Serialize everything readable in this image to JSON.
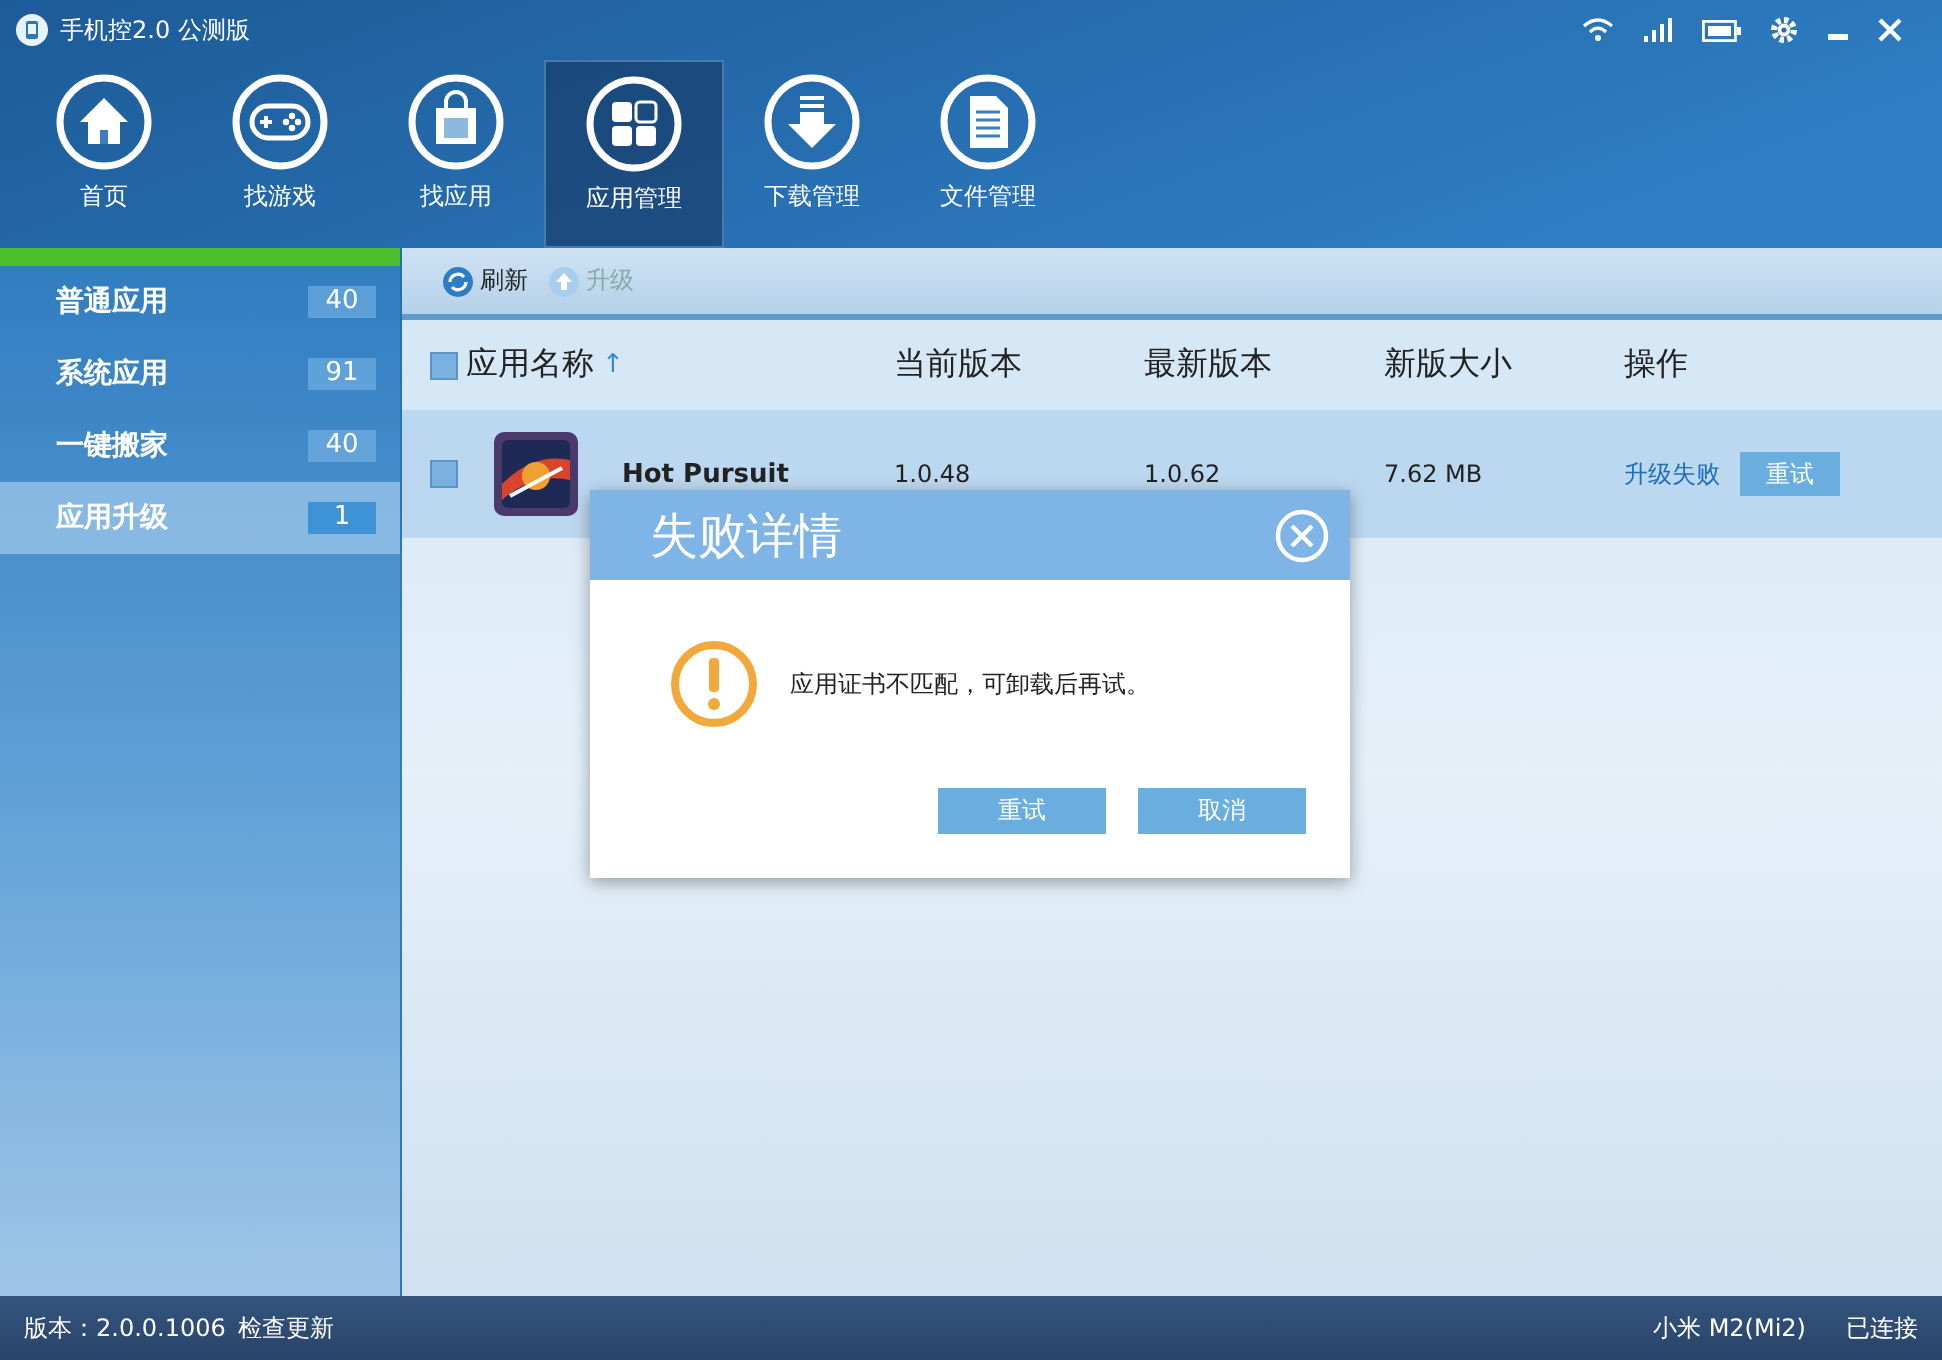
{
  "window": {
    "title": "手机控2.0 公测版"
  },
  "nav": [
    {
      "label": "首页",
      "kind": "home",
      "selected": false
    },
    {
      "label": "找游戏",
      "kind": "gamepad",
      "selected": false
    },
    {
      "label": "找应用",
      "kind": "bag",
      "selected": false
    },
    {
      "label": "应用管理",
      "kind": "grid",
      "selected": true
    },
    {
      "label": "下载管理",
      "kind": "download",
      "selected": false
    },
    {
      "label": "文件管理",
      "kind": "document",
      "selected": false
    }
  ],
  "sidebar": {
    "items": [
      {
        "label": "普通应用",
        "count": "40",
        "selected": false
      },
      {
        "label": "系统应用",
        "count": "91",
        "selected": false
      },
      {
        "label": "一键搬家",
        "count": "40",
        "selected": false
      },
      {
        "label": "应用升级",
        "count": "1",
        "selected": true
      }
    ]
  },
  "toolbar": [
    {
      "label": "刷新",
      "kind": "refresh",
      "disabled": false
    },
    {
      "label": "升级",
      "kind": "upgrade",
      "disabled": true
    }
  ],
  "table": {
    "header_checked": false,
    "sort_indicator": "↑",
    "columns": [
      "应用名称",
      "当前版本",
      "最新版本",
      "新版大小",
      "操作"
    ],
    "rows": [
      {
        "checked": false,
        "name": "Hot Pursuit",
        "current": "1.0.48",
        "latest": "1.0.62",
        "size": "7.62 MB",
        "status": "升级失败",
        "action": "重试"
      }
    ]
  },
  "dialog": {
    "title": "失败详情",
    "message": "应用证书不匹配，可卸载后再试。",
    "buttons": [
      "重试",
      "取消"
    ]
  },
  "status_bar": {
    "version": "版本：2.0.0.1006",
    "check_update": "检查更新",
    "device": "小米 M2(Mi2)",
    "connection": "已连接"
  }
}
